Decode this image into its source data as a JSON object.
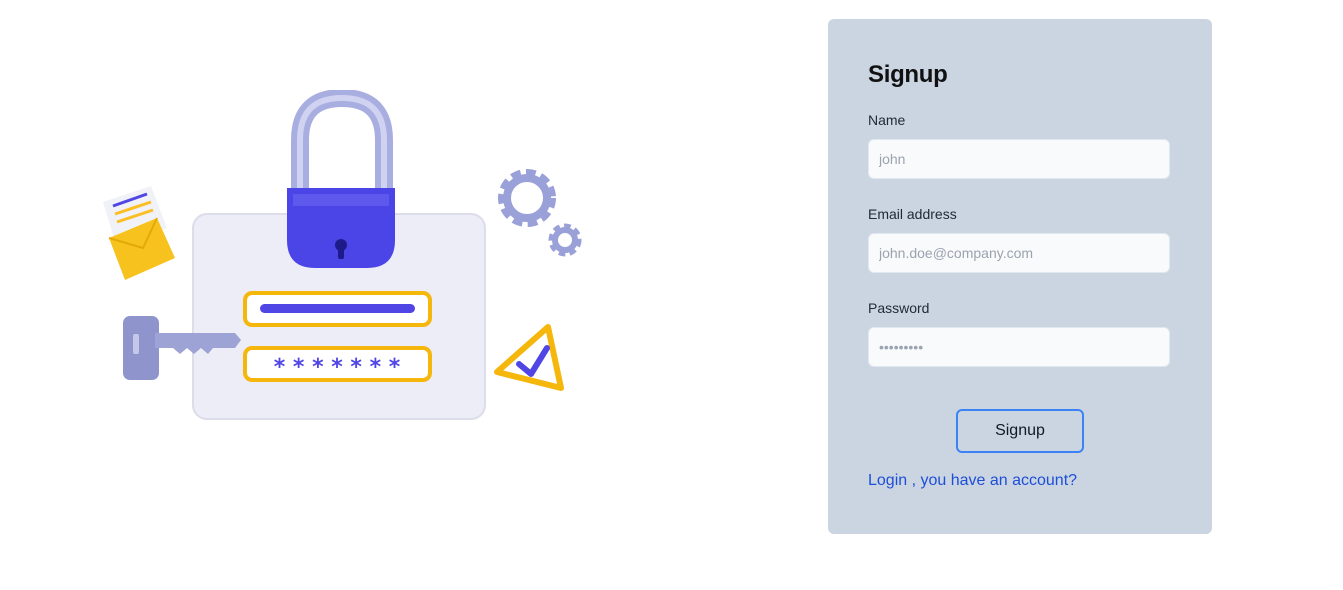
{
  "form": {
    "title": "Signup",
    "name_label": "Name",
    "name_placeholder": "john",
    "email_label": "Email address",
    "email_placeholder": "john.doe@company.com",
    "password_label": "Password",
    "password_placeholder": "•••••••••",
    "submit_label": "Signup",
    "login_link": "Login , you have an account?"
  },
  "illustration": {
    "icons": [
      "padlock-icon",
      "key-icon",
      "envelope-icon",
      "gear-icon",
      "check-badge-icon"
    ],
    "password_mask": "* * * * * * *"
  },
  "colors": {
    "card_background": "#cbd5e1",
    "accent": "#3b82f6",
    "link": "#1d4ed8",
    "illustration_primary": "#4f46e5",
    "illustration_yellow": "#fbbf24"
  }
}
